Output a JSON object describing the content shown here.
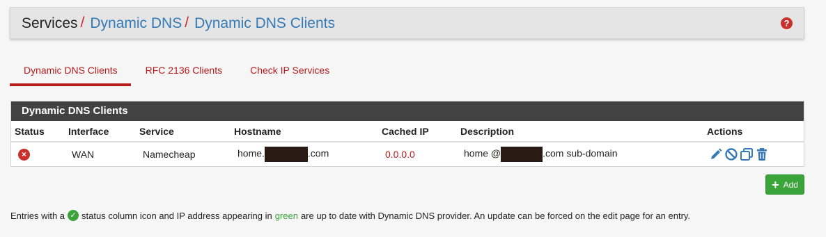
{
  "breadcrumb": {
    "root": "Services",
    "level2": "Dynamic DNS",
    "level3": "Dynamic DNS Clients",
    "separator": "/"
  },
  "help_icon": "?",
  "tabs": [
    {
      "label": "Dynamic DNS Clients",
      "active": true
    },
    {
      "label": "RFC 2136 Clients",
      "active": false
    },
    {
      "label": "Check IP Services",
      "active": false
    }
  ],
  "panel": {
    "title": "Dynamic DNS Clients",
    "columns": [
      "Status",
      "Interface",
      "Service",
      "Hostname",
      "Cached IP",
      "Description",
      "Actions"
    ],
    "rows": [
      {
        "status_icon": "×",
        "interface": "WAN",
        "service": "Namecheap",
        "hostname_prefix": "home.",
        "hostname_suffix": ".com",
        "cached_ip": "0.0.0.0",
        "description_prefix": "home @",
        "description_suffix": ".com sub-domain",
        "actions": [
          "edit-icon",
          "disable-icon",
          "copy-icon",
          "delete-icon"
        ]
      }
    ]
  },
  "add_button": {
    "label": "Add",
    "icon": "+"
  },
  "note": {
    "part1": "Entries with a",
    "check_icon": "✓",
    "part2": "status column icon and IP address appearing in",
    "green_word": "green",
    "part3": "are up to date with Dynamic DNS provider. An update can be forced on the edit page for an entry."
  },
  "colors": {
    "link": "#337ab7",
    "accent_red": "#b71c1c",
    "success_green": "#3aa33a",
    "panel_header": "#424242"
  }
}
